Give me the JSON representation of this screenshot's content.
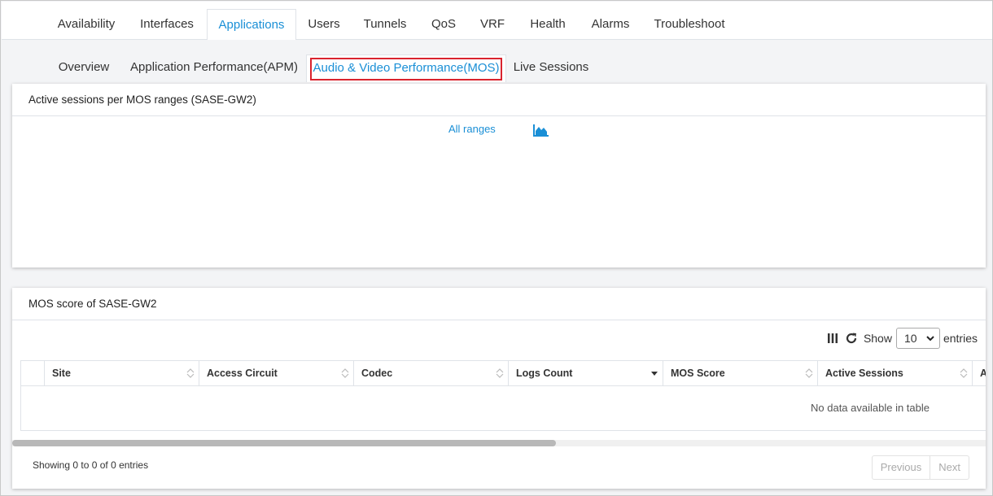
{
  "top_tabs": [
    {
      "label": "Availability"
    },
    {
      "label": "Interfaces"
    },
    {
      "label": "Applications"
    },
    {
      "label": "Users"
    },
    {
      "label": "Tunnels"
    },
    {
      "label": "QoS"
    },
    {
      "label": "VRF"
    },
    {
      "label": "Health"
    },
    {
      "label": "Alarms"
    },
    {
      "label": "Troubleshoot"
    }
  ],
  "active_top_tab": "Applications",
  "sub_tabs": [
    {
      "label": "Overview"
    },
    {
      "label": "Application Performance(APM)"
    },
    {
      "label": "Audio & Video Performance(MOS)"
    },
    {
      "label": "Live Sessions"
    }
  ],
  "active_sub_tab": "Audio & Video Performance(MOS)",
  "sessions_panel": {
    "title": "Active sessions per MOS ranges (SASE-GW2)",
    "range_link": "All ranges",
    "chart_icon": "area-chart-icon"
  },
  "mos_panel": {
    "title": "MOS score of SASE-GW2",
    "columns_icon": "columns-icon",
    "refresh_icon": "refresh-icon",
    "show_label": "Show",
    "show_value": "10",
    "entries_label": "entries",
    "columns": [
      "",
      "Site",
      "Access Circuit",
      "Codec",
      "Logs Count",
      "MOS Score",
      "Active Sessions",
      "A"
    ],
    "empty_message": "No data available in table",
    "info": "Showing 0 to 0 of 0 entries",
    "previous": "Previous",
    "next": "Next"
  },
  "colors": {
    "accent": "#1a8fd6",
    "highlight": "#d9232e",
    "background": "#f3f4f6"
  }
}
